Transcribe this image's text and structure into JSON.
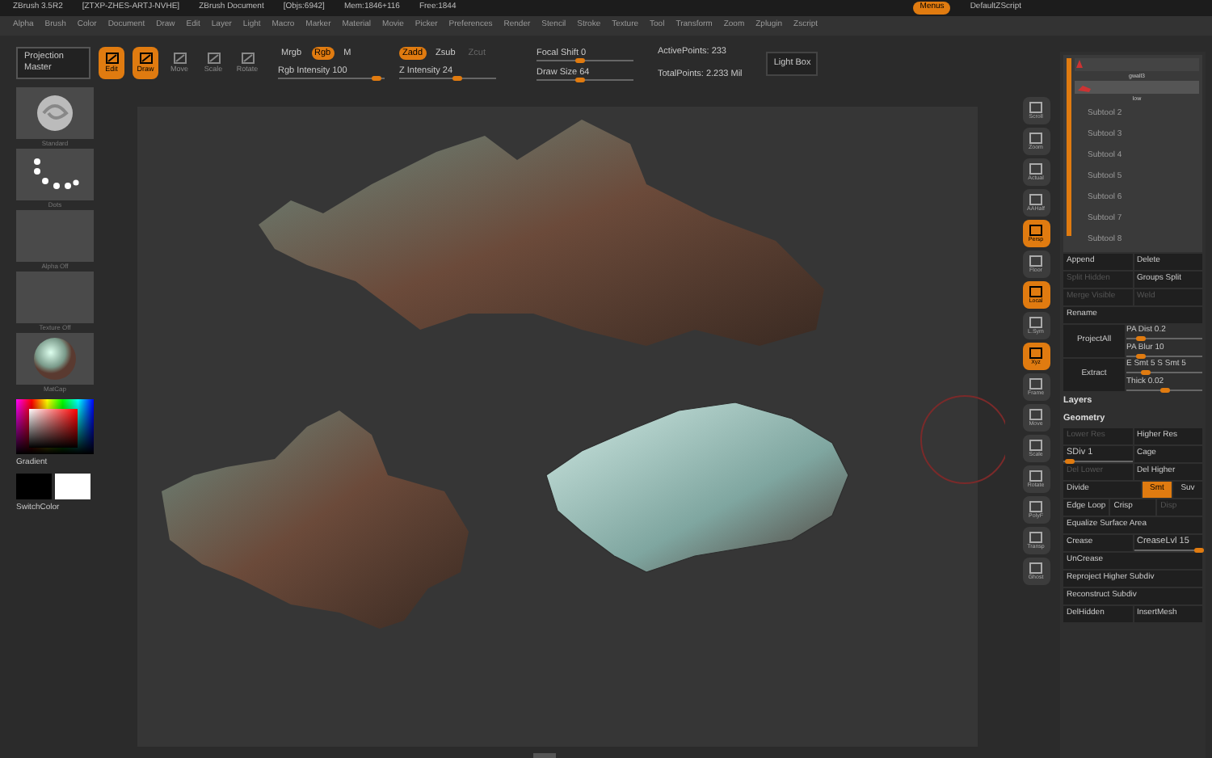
{
  "title_bar": {
    "items": [
      "ZBrush 3.5R2",
      "[ZTXP-ZHES-ARTJ-NVHE]",
      "ZBrush Document",
      "[Objs:6942]",
      "Mem:1846+116",
      "Free:1844"
    ],
    "menus_button": {
      "label": "Menus",
      "selected": true
    },
    "script": "DefaultZScript"
  },
  "menu_bar": [
    "Alpha",
    "Brush",
    "Color",
    "Document",
    "Draw",
    "Edit",
    "Layer",
    "Light",
    "Macro",
    "Marker",
    "Material",
    "Movie",
    "Picker",
    "Preferences",
    "Render",
    "Stencil",
    "Stroke",
    "Texture",
    "Tool",
    "Transform",
    "Zoom",
    "Zplugin",
    "Zscript"
  ],
  "shelf": {
    "projection_master": "Projection Master",
    "modes": [
      {
        "label": "Edit",
        "selected": true
      },
      {
        "label": "Draw",
        "selected": true
      },
      {
        "label": "Move",
        "selected": false
      },
      {
        "label": "Scale",
        "selected": false
      },
      {
        "label": "Rotate",
        "selected": false
      }
    ],
    "rgb_modes": [
      {
        "label": "Mrgb",
        "selected": false
      },
      {
        "label": "Rgb",
        "selected": true
      },
      {
        "label": "M",
        "selected": false
      }
    ],
    "z_modes": [
      {
        "label": "Zadd",
        "selected": true,
        "disabled": false
      },
      {
        "label": "Zsub",
        "selected": false,
        "disabled": false
      },
      {
        "label": "Zcut",
        "selected": false,
        "disabled": true
      }
    ],
    "sliders": [
      {
        "label": "Rgb Intensity 100",
        "level": 0.92
      },
      {
        "label": "Z Intensity 24",
        "level": 0.6
      },
      {
        "label": "Focal Shift 0",
        "level": 0.45
      },
      {
        "label": "Draw Size 64",
        "level": 0.45
      }
    ],
    "stats": [
      "ActivePoints: 233",
      "TotalPoints: 2.233 Mil"
    ],
    "light_box": "Light Box"
  },
  "left_shelf": {
    "thumbs": [
      {
        "label": "Standard",
        "kind": "brush"
      },
      {
        "label": "Dots",
        "kind": "stroke"
      },
      {
        "label": "Alpha Off",
        "kind": "empty"
      },
      {
        "label": "Texture Off",
        "kind": "empty"
      },
      {
        "label": "MatCap",
        "kind": "material"
      }
    ],
    "gradient": "Gradient",
    "switch_color": "SwitchColor"
  },
  "view_buttons": [
    {
      "label": "Scroll",
      "selected": false
    },
    {
      "label": "Zoom",
      "selected": false
    },
    {
      "label": "Actual",
      "selected": false
    },
    {
      "label": "AAHalf",
      "selected": false
    },
    {
      "label": "Persp",
      "selected": true
    },
    {
      "label": "Floor",
      "selected": false
    },
    {
      "label": "Local",
      "selected": true
    },
    {
      "label": "L.Sym",
      "selected": false
    },
    {
      "label": "Xyz",
      "selected": true
    },
    {
      "label": "Frame",
      "selected": false
    },
    {
      "label": "Move",
      "selected": false
    },
    {
      "label": "Scale",
      "selected": false
    },
    {
      "label": "Rotate",
      "selected": false
    },
    {
      "label": "PolyF",
      "selected": false
    },
    {
      "label": "Transp",
      "selected": false
    },
    {
      "label": "Ghost",
      "selected": false
    }
  ],
  "subtools": {
    "active": [
      {
        "name": "gwall3",
        "sub": "low"
      }
    ],
    "slots": [
      "Subtool 2",
      "Subtool 3",
      "Subtool 4",
      "Subtool 5",
      "Subtool 6",
      "Subtool 7",
      "Subtool 8"
    ]
  },
  "tool_rows": [
    [
      {
        "kind": "button",
        "label": "Append",
        "disabled": false
      },
      {
        "kind": "button",
        "label": "Delete",
        "disabled": false
      }
    ],
    [
      {
        "kind": "button",
        "label": "Split Hidden",
        "disabled": true
      },
      {
        "kind": "button",
        "label": "Groups Split",
        "disabled": false
      }
    ],
    [
      {
        "kind": "button",
        "label": "Merge Visible",
        "disabled": true
      },
      {
        "kind": "button",
        "label": "Weld",
        "disabled": true
      }
    ],
    [
      {
        "kind": "button",
        "label": "Rename",
        "disabled": false
      }
    ],
    [
      {
        "kind": "big",
        "label": "ProjectAll",
        "disabled": false
      },
      {
        "kind": "sliders",
        "items": [
          {
            "label": "PA Dist 0.2",
            "level": 0.2
          },
          {
            "label": "PA Blur 10",
            "level": 0.2
          }
        ]
      }
    ],
    [
      {
        "kind": "big",
        "label": "Extract",
        "disabled": false
      },
      {
        "kind": "sliders",
        "items": [
          {
            "label": "E Smt 5 S Smt 5",
            "level": 0.25
          },
          {
            "label": "Thick 0.02",
            "level": 0.5
          }
        ]
      }
    ],
    [
      {
        "kind": "header",
        "label": "Layers"
      }
    ],
    [
      {
        "kind": "header",
        "label": "Geometry"
      }
    ],
    [
      {
        "kind": "button",
        "label": "Lower Res",
        "disabled": true
      },
      {
        "kind": "button",
        "label": "Higher Res",
        "disabled": false
      }
    ],
    [
      {
        "kind": "slider",
        "label": "SDiv 1",
        "level": 0.1
      },
      {
        "kind": "button",
        "label": "Cage",
        "disabled": false
      }
    ],
    [
      {
        "kind": "button",
        "label": "Del Lower",
        "disabled": true
      },
      {
        "kind": "button",
        "label": "Del Higher",
        "disabled": false
      }
    ],
    [
      {
        "kind": "button",
        "label": "Divide",
        "disabled": false
      },
      {
        "kind": "toggle",
        "label": "Smt",
        "selected": true
      },
      {
        "kind": "toggle",
        "label": "Suv",
        "selected": false
      }
    ],
    [
      {
        "kind": "button",
        "label": "Edge Loop",
        "disabled": false
      },
      {
        "kind": "button",
        "label": "Crisp",
        "disabled": false
      },
      {
        "kind": "button",
        "label": "Disp",
        "disabled": true
      }
    ],
    [
      {
        "kind": "button",
        "label": "Equalize Surface Area",
        "disabled": false
      }
    ],
    [
      {
        "kind": "button",
        "label": "Crease",
        "disabled": false
      },
      {
        "kind": "slider",
        "label": "CreaseLvl 15",
        "level": 0.95
      }
    ],
    [
      {
        "kind": "button",
        "label": "UnCrease",
        "disabled": false
      }
    ],
    [
      {
        "kind": "button",
        "label": "Reproject Higher Subdiv",
        "disabled": false
      }
    ],
    [
      {
        "kind": "button",
        "label": "Reconstruct Subdiv",
        "disabled": false
      }
    ],
    [
      {
        "kind": "button",
        "label": "DelHidden",
        "disabled": false
      },
      {
        "kind": "button",
        "label": "InsertMesh",
        "disabled": false
      }
    ]
  ]
}
